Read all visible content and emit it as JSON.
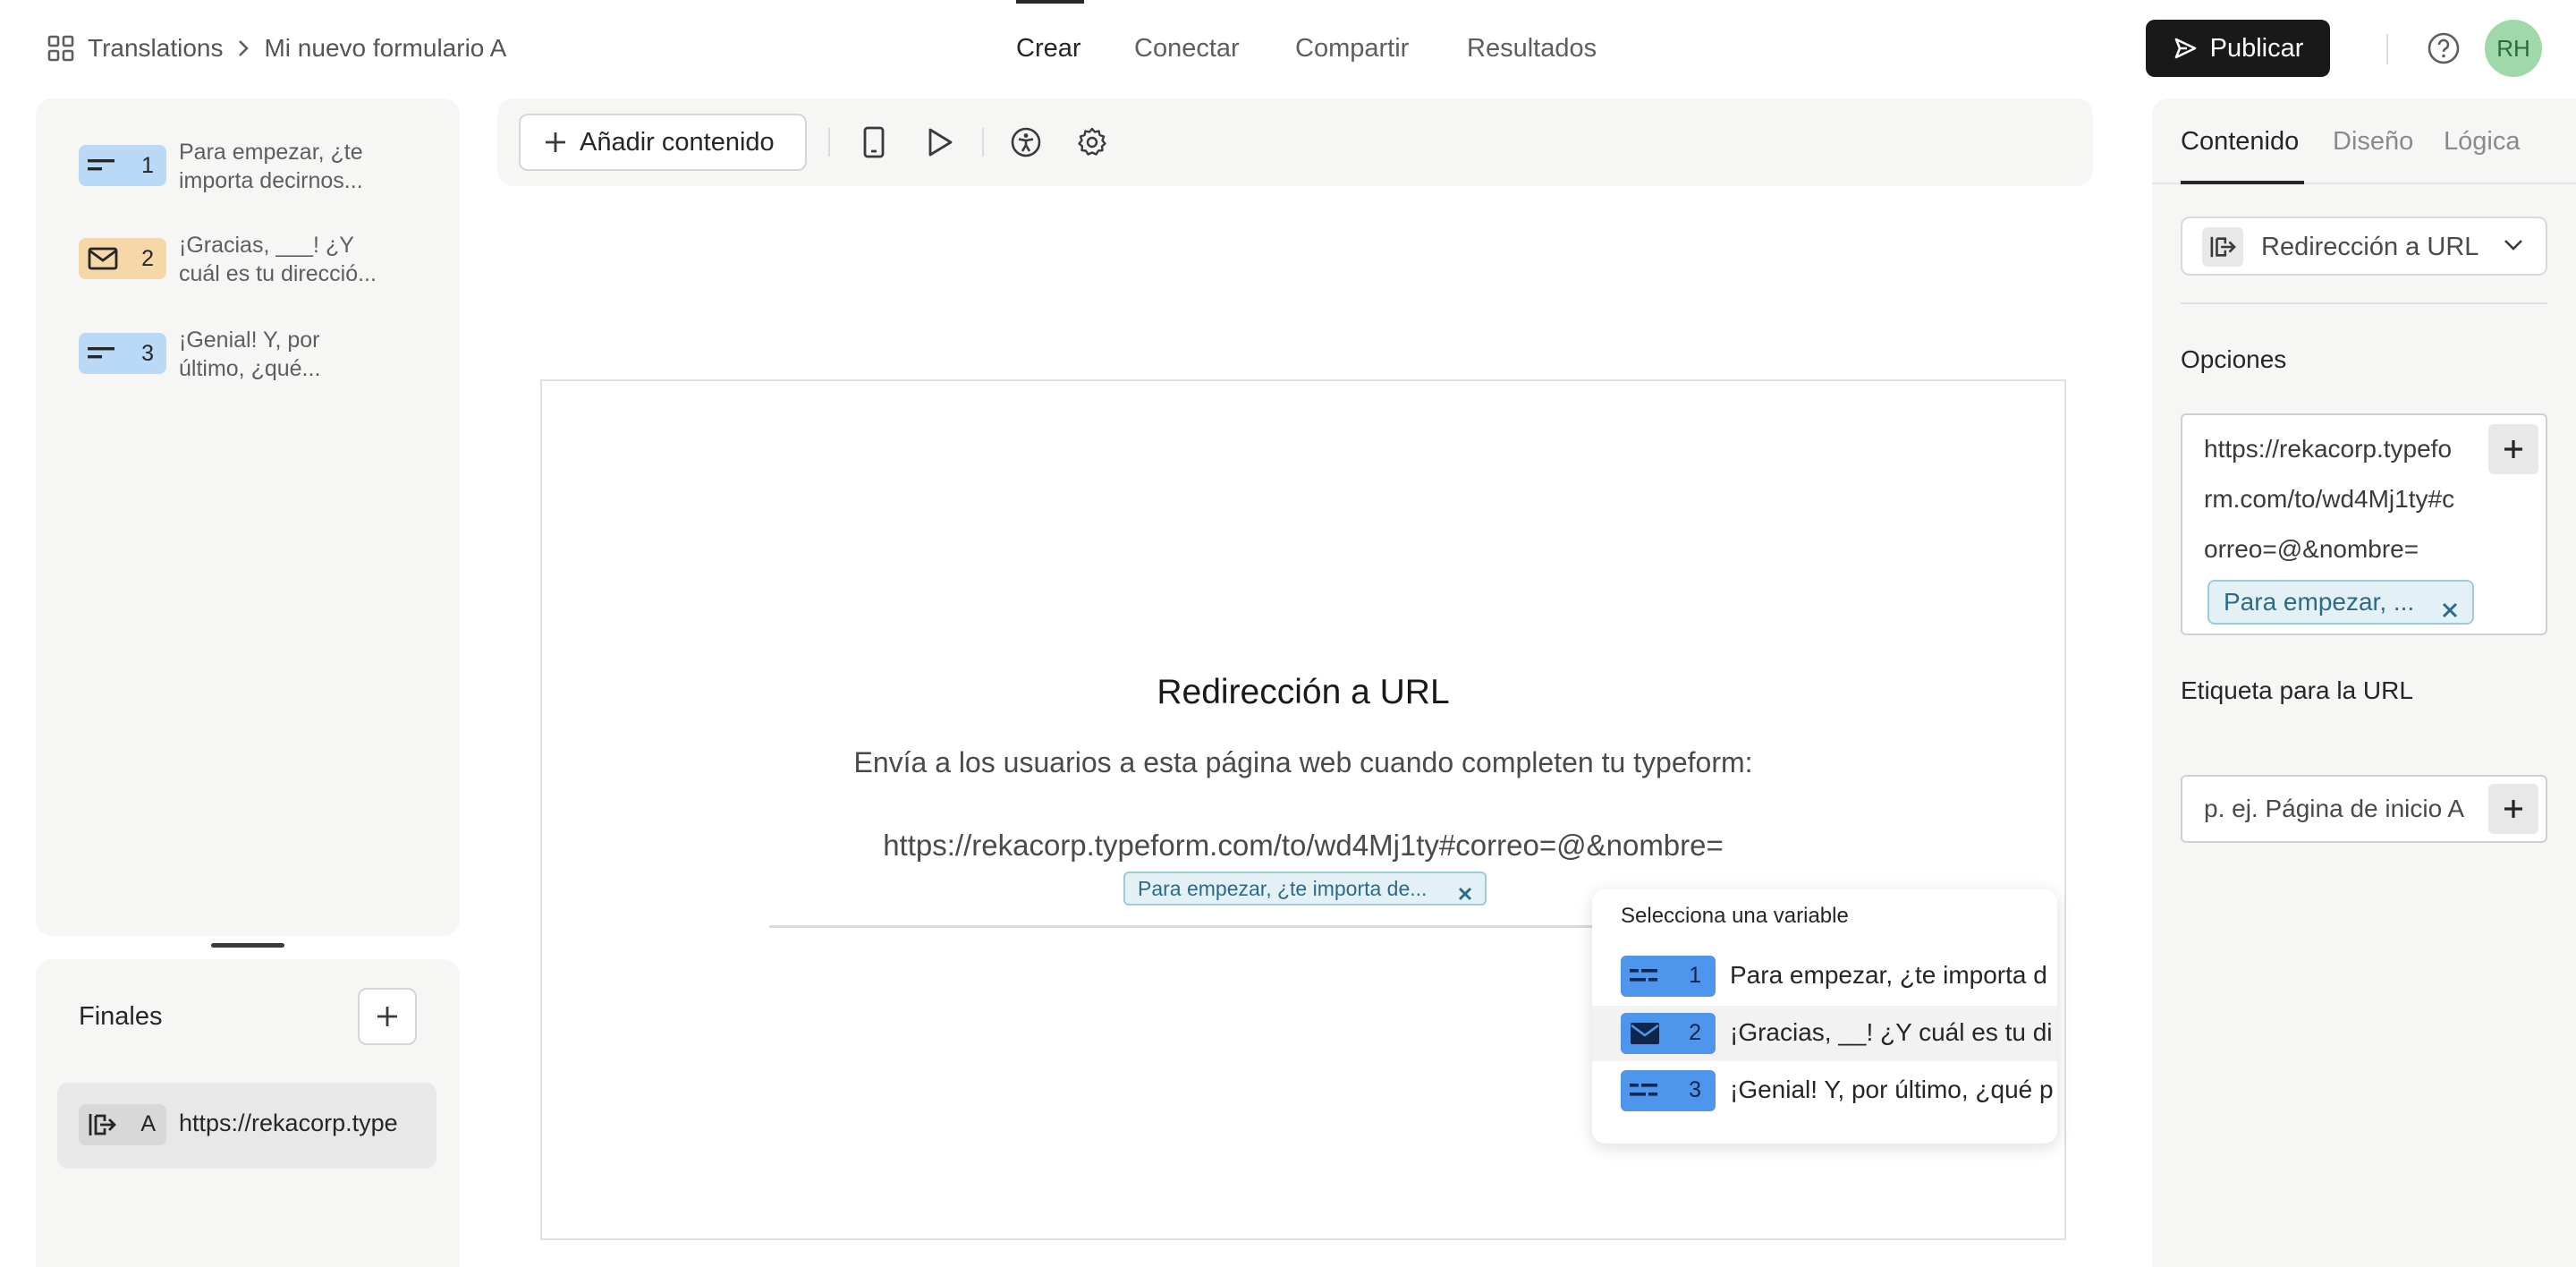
{
  "header": {
    "breadcrumb_root": "Translations",
    "breadcrumb_form": "Mi nuevo formulario A",
    "tabs": [
      "Crear",
      "Conectar",
      "Compartir",
      "Resultados"
    ],
    "active_tab": "Crear",
    "publish_label": "Publicar",
    "avatar_initials": "RH"
  },
  "questions": [
    {
      "number": "1",
      "line1": "Para empezar, ¿te",
      "line2": "importa decirnos...",
      "type_icon": "short-text-icon",
      "color": "#b9d9f7"
    },
    {
      "number": "2",
      "line1": "¡Gracias, ___! ¿Y",
      "line2": "cuál es tu direcció...",
      "type_icon": "email-icon",
      "color": "#f5d7a8"
    },
    {
      "number": "3",
      "line1": "¡Genial! Y, por",
      "line2": "último, ¿qué...",
      "type_icon": "short-text-icon",
      "color": "#b9d9f7"
    }
  ],
  "endings": {
    "title": "Finales",
    "item_letter": "A",
    "item_text": "https://rekacorp.type"
  },
  "toolbar": {
    "add_content_label": "Añadir contenido"
  },
  "canvas": {
    "title": "Redirección a URL",
    "description": "Envía a los usuarios a esta página web cuando completen tu typeform:",
    "url": "https://rekacorp.typeform.com/to/wd4Mj1ty#correo=@&nombre=",
    "chip": "Para empezar, ¿te importa de..."
  },
  "variable_dropdown": {
    "title": "Selecciona una variable",
    "items": [
      {
        "number": "1",
        "text": "Para empezar, ¿te importa d"
      },
      {
        "number": "2",
        "text": "¡Gracias, __! ¿Y cuál es tu di"
      },
      {
        "number": "3",
        "text": "¡Genial! Y, por último, ¿qué p"
      }
    ]
  },
  "right_panel": {
    "tabs": [
      "Contenido",
      "Diseño",
      "Lógica"
    ],
    "active_tab": "Contenido",
    "ending_type": "Redirección a URL",
    "options_label": "Opciones",
    "url_lines": [
      "https://rekacorp.typefo",
      "rm.com/to/wd4Mj1ty#c",
      "orreo=@&nombre="
    ],
    "url_chip": "Para empezar, ...",
    "url_label_title": "Etiqueta para la URL",
    "url_label_placeholder": "p. ej. Página de inicio A"
  },
  "colors": {
    "accent_dark": "#191919",
    "badge_blue": "#b9d9f7",
    "badge_orange": "#f5d7a8",
    "dropdown_badge": "#4e95ec",
    "chip_bg": "#e3f1f7"
  }
}
